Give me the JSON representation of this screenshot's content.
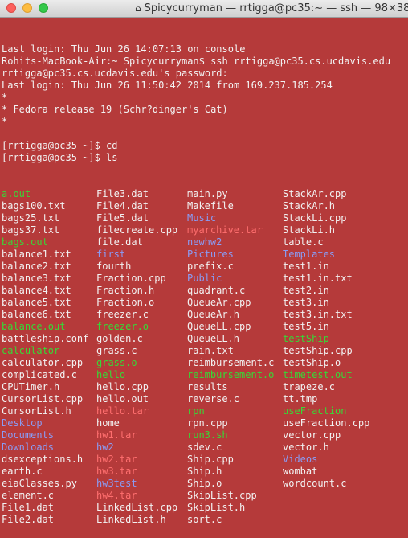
{
  "window": {
    "title": "Spicycurryman — rrtigga@pc35:~ — ssh — 98×38"
  },
  "session_lines": [
    "Last login: Thu Jun 26 14:07:13 on console",
    "Rohits-MacBook-Air:~ Spicycurryman$ ssh rrtigga@pc35.cs.ucdavis.edu",
    "rrtigga@pc35.cs.ucdavis.edu's password:",
    "Last login: Thu Jun 26 11:50:42 2014 from 169.237.185.254",
    "*",
    "* Fedora release 19 (Schr?dinger's Cat)",
    "*",
    "",
    "[rrtigga@pc35 ~]$ cd",
    "[rrtigga@pc35 ~]$ ls"
  ],
  "listing": [
    [
      {
        "t": "a.out",
        "c": "green"
      },
      {
        "t": "File3.dat",
        "c": ""
      },
      {
        "t": "main.py",
        "c": ""
      },
      {
        "t": "StackAr.cpp",
        "c": ""
      }
    ],
    [
      {
        "t": "bags100.txt",
        "c": ""
      },
      {
        "t": "File4.dat",
        "c": ""
      },
      {
        "t": "Makefile",
        "c": ""
      },
      {
        "t": "StackAr.h",
        "c": ""
      }
    ],
    [
      {
        "t": "bags25.txt",
        "c": ""
      },
      {
        "t": "File5.dat",
        "c": ""
      },
      {
        "t": "Music",
        "c": "blue"
      },
      {
        "t": "StackLi.cpp",
        "c": ""
      }
    ],
    [
      {
        "t": "bags37.txt",
        "c": ""
      },
      {
        "t": "filecreate.cpp",
        "c": ""
      },
      {
        "t": "myarchive.tar",
        "c": "red"
      },
      {
        "t": "StackLi.h",
        "c": ""
      }
    ],
    [
      {
        "t": "bags.out",
        "c": "green"
      },
      {
        "t": "file.dat",
        "c": ""
      },
      {
        "t": "newhw2",
        "c": "blue"
      },
      {
        "t": "table.c",
        "c": ""
      }
    ],
    [
      {
        "t": "balance1.txt",
        "c": ""
      },
      {
        "t": "first",
        "c": "blue"
      },
      {
        "t": "Pictures",
        "c": "blue"
      },
      {
        "t": "Templates",
        "c": "blue"
      }
    ],
    [
      {
        "t": "balance2.txt",
        "c": ""
      },
      {
        "t": "fourth",
        "c": ""
      },
      {
        "t": "prefix.c",
        "c": ""
      },
      {
        "t": "test1.in",
        "c": ""
      }
    ],
    [
      {
        "t": "balance3.txt",
        "c": ""
      },
      {
        "t": "Fraction.cpp",
        "c": ""
      },
      {
        "t": "Public",
        "c": "blue"
      },
      {
        "t": "test1.in.txt",
        "c": ""
      }
    ],
    [
      {
        "t": "balance4.txt",
        "c": ""
      },
      {
        "t": "Fraction.h",
        "c": ""
      },
      {
        "t": "quadrant.c",
        "c": ""
      },
      {
        "t": "test2.in",
        "c": ""
      }
    ],
    [
      {
        "t": "balance5.txt",
        "c": ""
      },
      {
        "t": "Fraction.o",
        "c": ""
      },
      {
        "t": "QueueAr.cpp",
        "c": ""
      },
      {
        "t": "test3.in",
        "c": ""
      }
    ],
    [
      {
        "t": "balance6.txt",
        "c": ""
      },
      {
        "t": "freezer.c",
        "c": ""
      },
      {
        "t": "QueueAr.h",
        "c": ""
      },
      {
        "t": "test3.in.txt",
        "c": ""
      }
    ],
    [
      {
        "t": "balance.out",
        "c": "green"
      },
      {
        "t": "freezer.o",
        "c": "green"
      },
      {
        "t": "QueueLL.cpp",
        "c": ""
      },
      {
        "t": "test5.in",
        "c": ""
      }
    ],
    [
      {
        "t": "battleship.conf",
        "c": ""
      },
      {
        "t": "golden.c",
        "c": ""
      },
      {
        "t": "QueueLL.h",
        "c": ""
      },
      {
        "t": "testShip",
        "c": "green"
      }
    ],
    [
      {
        "t": "calculator",
        "c": "green"
      },
      {
        "t": "grass.c",
        "c": ""
      },
      {
        "t": "rain.txt",
        "c": ""
      },
      {
        "t": "testShip.cpp",
        "c": ""
      }
    ],
    [
      {
        "t": "calculator.cpp",
        "c": ""
      },
      {
        "t": "grass.o",
        "c": "green"
      },
      {
        "t": "reimbursement.c",
        "c": ""
      },
      {
        "t": "testShip.o",
        "c": ""
      }
    ],
    [
      {
        "t": "complicated.c",
        "c": ""
      },
      {
        "t": "hello",
        "c": "green"
      },
      {
        "t": "reimbursement.o",
        "c": "green"
      },
      {
        "t": "timetest.out",
        "c": "green"
      }
    ],
    [
      {
        "t": "CPUTimer.h",
        "c": ""
      },
      {
        "t": "hello.cpp",
        "c": ""
      },
      {
        "t": "results",
        "c": ""
      },
      {
        "t": "trapeze.c",
        "c": ""
      }
    ],
    [
      {
        "t": "CursorList.cpp",
        "c": ""
      },
      {
        "t": "hello.out",
        "c": ""
      },
      {
        "t": "reverse.c",
        "c": ""
      },
      {
        "t": "tt.tmp",
        "c": ""
      }
    ],
    [
      {
        "t": "CursorList.h",
        "c": ""
      },
      {
        "t": "hello.tar",
        "c": "red"
      },
      {
        "t": "rpn",
        "c": "green"
      },
      {
        "t": "useFraction",
        "c": "green"
      }
    ],
    [
      {
        "t": "Desktop",
        "c": "blue"
      },
      {
        "t": "home",
        "c": ""
      },
      {
        "t": "rpn.cpp",
        "c": ""
      },
      {
        "t": "useFraction.cpp",
        "c": ""
      }
    ],
    [
      {
        "t": "Documents",
        "c": "blue"
      },
      {
        "t": "hw1.tar",
        "c": "red"
      },
      {
        "t": "run3.sh",
        "c": "green"
      },
      {
        "t": "vector.cpp",
        "c": ""
      }
    ],
    [
      {
        "t": "Downloads",
        "c": "blue"
      },
      {
        "t": "hw2",
        "c": "blue"
      },
      {
        "t": "sdev.c",
        "c": ""
      },
      {
        "t": "vector.h",
        "c": ""
      }
    ],
    [
      {
        "t": "dsexceptions.h",
        "c": ""
      },
      {
        "t": "hw2.tar",
        "c": "red"
      },
      {
        "t": "Ship.cpp",
        "c": ""
      },
      {
        "t": "Videos",
        "c": "blue"
      }
    ],
    [
      {
        "t": "earth.c",
        "c": ""
      },
      {
        "t": "hw3.tar",
        "c": "red"
      },
      {
        "t": "Ship.h",
        "c": ""
      },
      {
        "t": "wombat",
        "c": ""
      }
    ],
    [
      {
        "t": "eiaClasses.py",
        "c": ""
      },
      {
        "t": "hw3test",
        "c": "blue"
      },
      {
        "t": "Ship.o",
        "c": ""
      },
      {
        "t": "wordcount.c",
        "c": ""
      }
    ],
    [
      {
        "t": "element.c",
        "c": ""
      },
      {
        "t": "hw4.tar",
        "c": "red"
      },
      {
        "t": "SkipList.cpp",
        "c": ""
      },
      {
        "t": "",
        "c": ""
      }
    ],
    [
      {
        "t": "File1.dat",
        "c": ""
      },
      {
        "t": "LinkedList.cpp",
        "c": ""
      },
      {
        "t": "SkipList.h",
        "c": ""
      },
      {
        "t": "",
        "c": ""
      }
    ],
    [
      {
        "t": "File2.dat",
        "c": ""
      },
      {
        "t": "LinkedList.h",
        "c": ""
      },
      {
        "t": "sort.c",
        "c": ""
      },
      {
        "t": "",
        "c": ""
      }
    ]
  ],
  "colors": {
    "background": "#b53a3a",
    "text": "#f2f2f2",
    "executable": "#37d937",
    "directory": "#8a9cf5",
    "archive": "#ff6f6f"
  }
}
